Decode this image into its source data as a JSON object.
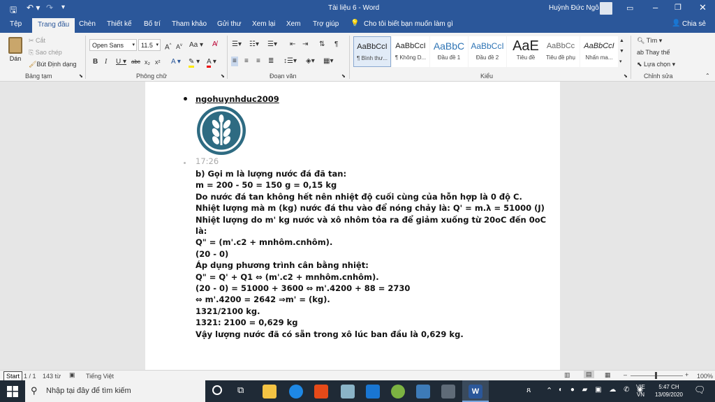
{
  "window": {
    "title": "Tài liệu 6  -  Word",
    "user": "Huỳnh Đức Ngô"
  },
  "tabs": [
    "Tệp",
    "Trang đầu",
    "Chèn",
    "Thiết kế",
    "Bố trí",
    "Tham khảo",
    "Gửi thư",
    "Xem lại",
    "Xem",
    "Trợ giúp"
  ],
  "tell_me": "Cho tôi biết bạn muốn làm gì",
  "share": "Chia sẻ",
  "clipboard": {
    "paste": "Dán",
    "cut": "Cắt",
    "copy": "Sao chép",
    "format_painter": "Bút Định dạng",
    "group": "Bảng tạm"
  },
  "font": {
    "name": "Open Sans",
    "size": "11.5",
    "group": "Phông chữ"
  },
  "paragraph": {
    "group": "Đoạn văn"
  },
  "styles": {
    "group": "Kiểu",
    "items": [
      {
        "preview": "AaBbCcI",
        "name": "¶ Bình thư..."
      },
      {
        "preview": "AaBbCcI",
        "name": "¶ Không D..."
      },
      {
        "preview": "AaBbC",
        "name": "Đầu đề 1"
      },
      {
        "preview": "AaBbCcI",
        "name": "Đầu đề 2"
      },
      {
        "preview": "AaE",
        "name": "Tiêu đề"
      },
      {
        "preview": "AaBbCc",
        "name": "Tiêu đề phụ"
      },
      {
        "preview": "AaBbCcI",
        "name": "Nhấn ma..."
      }
    ]
  },
  "editing": {
    "find": "Tìm",
    "replace": "Thay thế",
    "select": "Lựa chọn",
    "group": "Chỉnh sửa"
  },
  "document": {
    "author": "ngohuynhduc2009",
    "time": "17:26",
    "lines": [
      "b) Gọi m là lượng nước đá đã tan:",
      "m = 200 - 50 = 150 g = 0,15 kg",
      "Do nước đá tan không hết nên nhiệt độ cuối cùng của hỗn hợp là 0 độ C.",
      "Nhiệt lượng mà m (kg) nước đá thu vào để nóng chảy là: Q' = m.λ = 51000 (J)",
      "Nhiệt lượng do m' kg nước và xô nhôm tỏa ra để giảm xuống từ 20oC đến 0oC",
      "là:",
      "Q\" = (m'.c2 + mnhôm.cnhôm).",
      "(20 - 0)",
      "Áp dụng phương trình cân bằng nhiệt:",
      "Q\" = Q' + Q1 ⇔ (m'.c2 + mnhôm.cnhôm).",
      "(20 - 0) = 51000 + 3600 ⇔ m'.4200 + 88 = 2730",
      "⇔ m'.4200 = 2642 ⇒m' = (kg).",
      " 1321/2100 kg.",
      "1321: 2100 = 0,629 kg",
      "Vậy lượng nước đã có sẵn trong xô lúc ban đầu là 0,629 kg."
    ]
  },
  "status": {
    "start": "Start",
    "page": "1 / 1",
    "words": "143 từ",
    "language": "Tiếng Việt",
    "zoom": "100%"
  },
  "taskbar": {
    "search_placeholder": "Nhập tại đây để tìm kiếm",
    "lang1": "VIE",
    "lang2": "VN",
    "time": "5:47 CH",
    "date": "13/09/2020"
  }
}
